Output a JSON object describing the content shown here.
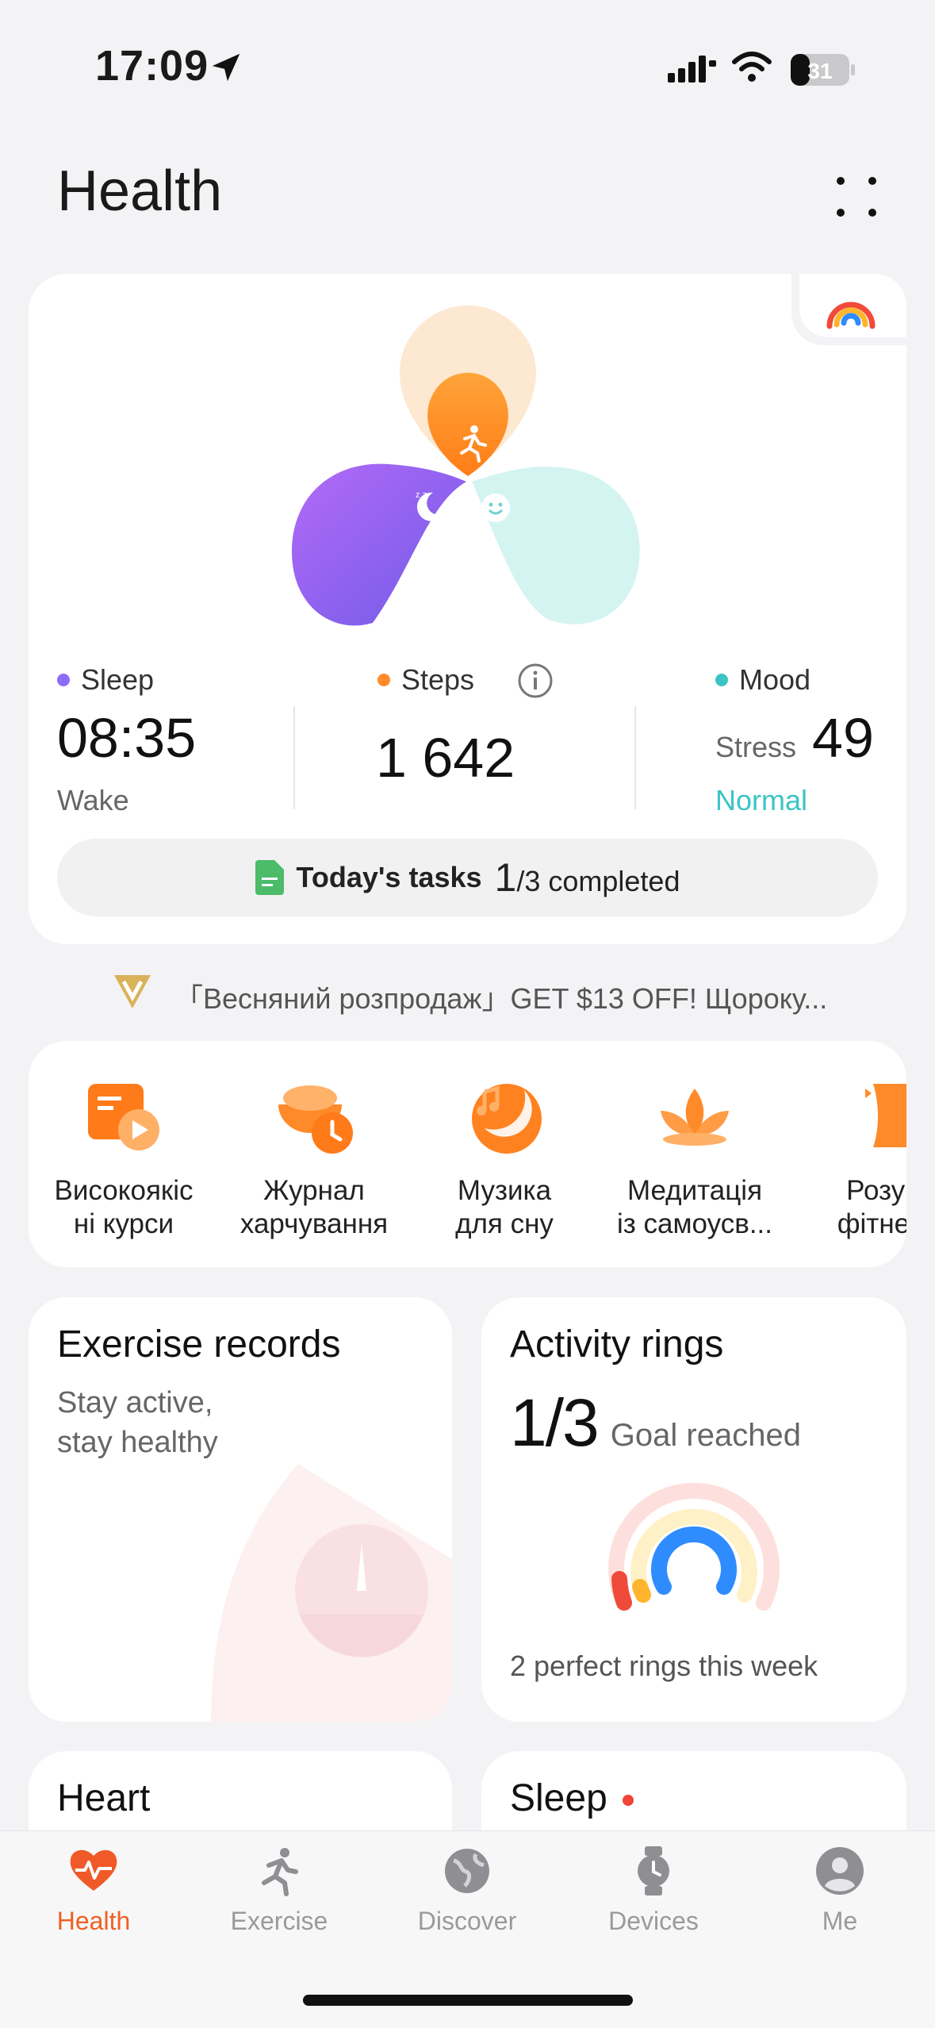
{
  "status_bar": {
    "time": "17:09",
    "battery": "31",
    "icons": [
      "location-arrow-icon",
      "signal-icon",
      "wifi-icon",
      "battery-icon"
    ]
  },
  "header": {
    "title": "Health",
    "more_icon": "grid-dots-icon"
  },
  "summary": {
    "sleep": {
      "label": "Sleep",
      "value": "08:35",
      "sub": "Wake",
      "color": "#8b6cf6"
    },
    "steps": {
      "label": "Steps",
      "value": "1 642",
      "color": "#ff8a2a"
    },
    "mood": {
      "label": "Mood",
      "stress_label": "Stress",
      "stress_value": "49",
      "status": "Normal",
      "color": "#3cc4c4"
    },
    "tasks": {
      "label": "Today's tasks",
      "done": "1",
      "total_text": "/3 completed"
    }
  },
  "promo": {
    "text": "「Весняний розпродаж」GET  $13 OFF!  Щороку..."
  },
  "services": [
    {
      "label": "Високоякіс\nні курси",
      "icon": "video-course-icon"
    },
    {
      "label": "Журнал\nхарчування",
      "icon": "food-journal-icon"
    },
    {
      "label": "Музика\nдля сну",
      "icon": "sleep-music-icon"
    },
    {
      "label": "Медитація\nіз самоусв...",
      "icon": "meditation-lotus-icon"
    },
    {
      "label": "Розум\nфітнес-",
      "icon": "body-fitness-icon"
    }
  ],
  "tiles": {
    "exercise": {
      "title": "Exercise records",
      "sub1": "Stay active,",
      "sub2": "stay healthy"
    },
    "activity": {
      "title": "Activity rings",
      "value": "1/3",
      "value_label": "Goal reached",
      "footer": "2 perfect rings this week",
      "progress_fraction": 0.333
    },
    "heart": {
      "title": "Heart"
    },
    "sleep": {
      "title": "Sleep"
    }
  },
  "tabs": [
    {
      "label": "Health",
      "icon": "heart-pulse-icon",
      "active": true
    },
    {
      "label": "Exercise",
      "icon": "running-icon",
      "active": false
    },
    {
      "label": "Discover",
      "icon": "globe-icon",
      "active": false
    },
    {
      "label": "Devices",
      "icon": "watch-icon",
      "active": false
    },
    {
      "label": "Me",
      "icon": "person-icon",
      "active": false
    }
  ],
  "colors": {
    "accent": "#f06022",
    "sleep": "#8b6cf6",
    "steps": "#ff8a2a",
    "mood": "#3cc4c4"
  }
}
